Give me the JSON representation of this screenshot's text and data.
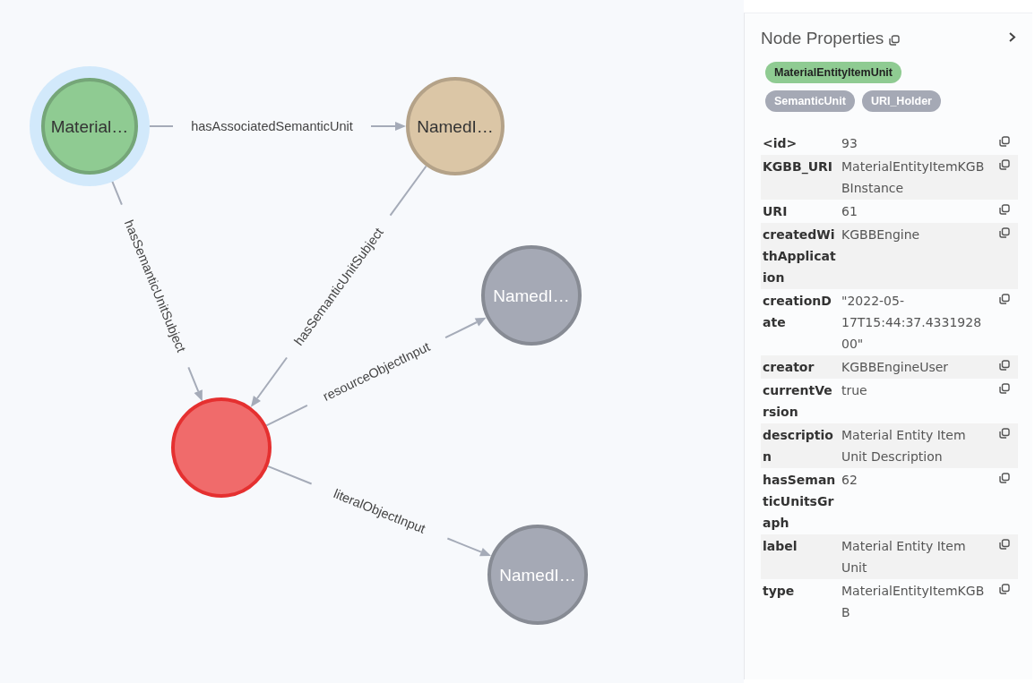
{
  "graph": {
    "nodes": [
      {
        "label": "Material…",
        "color": "#8fcb92",
        "selected": true
      },
      {
        "label": "NamedI…",
        "color": "#dbc6a6",
        "selected": false
      },
      {
        "label": "NamedI…",
        "color": "#a5a9b5",
        "selected": false
      },
      {
        "color": "#f06b6b",
        "selected": false
      },
      {
        "label": "NamedI…",
        "color": "#a5a9b5",
        "selected": false
      }
    ],
    "edges": [
      {
        "label": "hasAssociatedSemanticUnit"
      },
      {
        "label": "hasSemanticUnitSubject"
      },
      {
        "label": "hasSemanticUnitSubject"
      },
      {
        "label": "resourceObjectInput"
      },
      {
        "label": "literalObjectInput"
      }
    ]
  },
  "panel": {
    "title": "Node Properties",
    "labels": [
      {
        "text": "MaterialEntityItemUnit",
        "color": "#8fcb92"
      },
      {
        "text": "SemanticUnit",
        "color": "#a5a9b5"
      },
      {
        "text": "URI_Holder",
        "color": "#a5a9b5"
      }
    ],
    "properties": [
      {
        "key": "<id>",
        "value": "93"
      },
      {
        "key": "KGBB_URI",
        "value": "MaterialEntityItemKGBBInstance"
      },
      {
        "key": "URI",
        "value": "61"
      },
      {
        "key": "createdWithApplication",
        "value": "KGBBEngine"
      },
      {
        "key": "creationDate",
        "value": "\"2022-05-17T15:44:37.433192800\""
      },
      {
        "key": "creator",
        "value": "KGBBEngineUser"
      },
      {
        "key": "currentVersion",
        "value": "true"
      },
      {
        "key": "description",
        "value": "Material Entity Item Unit Description"
      },
      {
        "key": "hasSemanticUnitsGraph",
        "value": "62"
      },
      {
        "key": "label",
        "value": "Material Entity Item Unit"
      },
      {
        "key": "type",
        "value": "MaterialEntityItemKGBB"
      }
    ]
  }
}
